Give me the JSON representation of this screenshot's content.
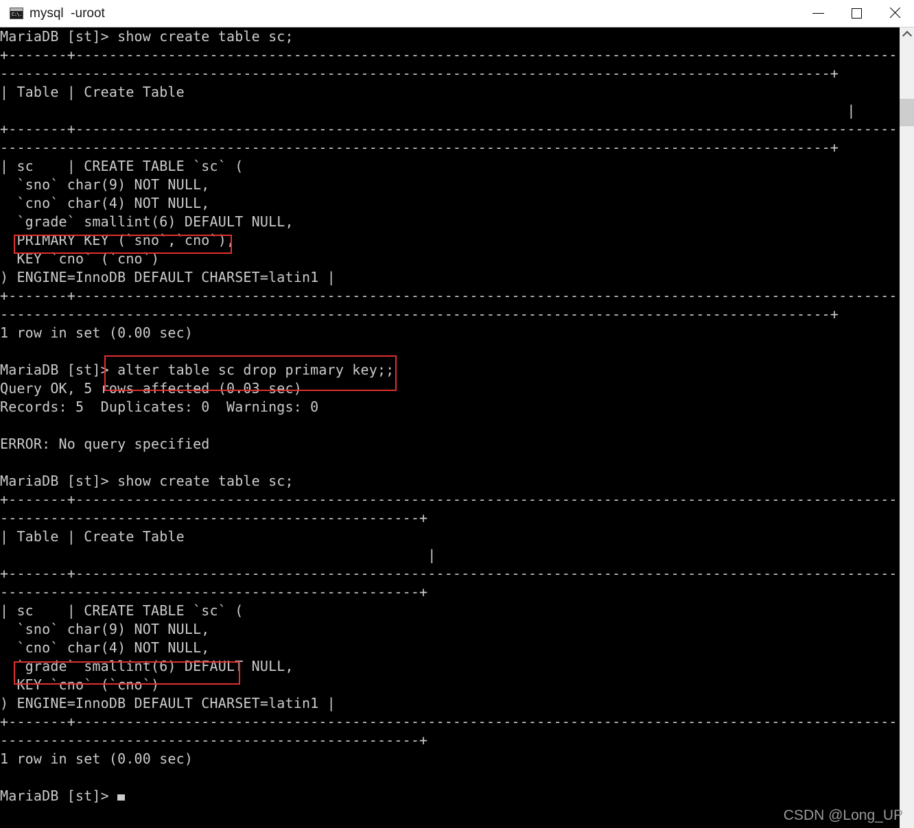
{
  "window": {
    "title": "mysql  -uroot",
    "icon": "cmd-console-icon",
    "icon_label": "C:\\.",
    "controls": {
      "minimize": "Minimize",
      "maximize": "Maximize",
      "close": "Close"
    }
  },
  "colors": {
    "titlebar_bg": "#ffffff",
    "console_bg": "#000000",
    "console_fg": "#cccccc",
    "highlight": "#e03030",
    "window_border": "#2a6fc9",
    "scrollbar_track": "#f0f0f0",
    "scrollbar_thumb": "#cdcdcd"
  },
  "scrollbar": {
    "up_arrow": "chevron-up-icon",
    "thumb_position_pct": 9
  },
  "watermark": "CSDN @Long_UP",
  "terminal": {
    "prompt": "MariaDB [st]>",
    "cursor": "block-cursor",
    "lines": [
      "MariaDB [st]> show create table sc;",
      "+-------+---------------------------------------------------------------------------------------------------",
      "---------------------------------------------------------------------------------------------------+",
      "| Table | Create Table",
      "                                                                                                     |",
      "+-------+---------------------------------------------------------------------------------------------------",
      "---------------------------------------------------------------------------------------------------+",
      "| sc    | CREATE TABLE `sc` (",
      "  `sno` char(9) NOT NULL,",
      "  `cno` char(4) NOT NULL,",
      "  `grade` smallint(6) DEFAULT NULL,",
      "  PRIMARY KEY (`sno`,`cno`),",
      "  KEY `cno` (`cno`)",
      ") ENGINE=InnoDB DEFAULT CHARSET=latin1 |",
      "+-------+---------------------------------------------------------------------------------------------------",
      "---------------------------------------------------------------------------------------------------+",
      "1 row in set (0.00 sec)",
      "",
      "MariaDB [st]> alter table sc drop primary key;;",
      "Query OK, 5 rows affected (0.03 sec)",
      "Records: 5  Duplicates: 0  Warnings: 0",
      "",
      "ERROR: No query specified",
      "",
      "MariaDB [st]> show create table sc;",
      "+-------+---------------------------------------------------------------------------------------------------",
      "--------------------------------------------------+",
      "| Table | Create Table",
      "                                                   |",
      "+-------+---------------------------------------------------------------------------------------------------",
      "--------------------------------------------------+",
      "| sc    | CREATE TABLE `sc` (",
      "  `sno` char(9) NOT NULL,",
      "  `cno` char(4) NOT NULL,",
      "  `grade` smallint(6) DEFAULT NULL,",
      "  KEY `cno` (`cno`)",
      ") ENGINE=InnoDB DEFAULT CHARSET=latin1 |",
      "+-------+---------------------------------------------------------------------------------------------------",
      "--------------------------------------------------+",
      "1 row in set (0.00 sec)",
      "",
      "MariaDB [st]> "
    ],
    "highlights": [
      {
        "name": "primary-key-line",
        "text": "PRIMARY KEY (`sno`,`cno`),"
      },
      {
        "name": "alter-table-command",
        "text": "alter table sc drop primary key;;"
      },
      {
        "name": "grade-column-line",
        "text": "`grade` smallint(6) DEFAULT"
      }
    ]
  }
}
